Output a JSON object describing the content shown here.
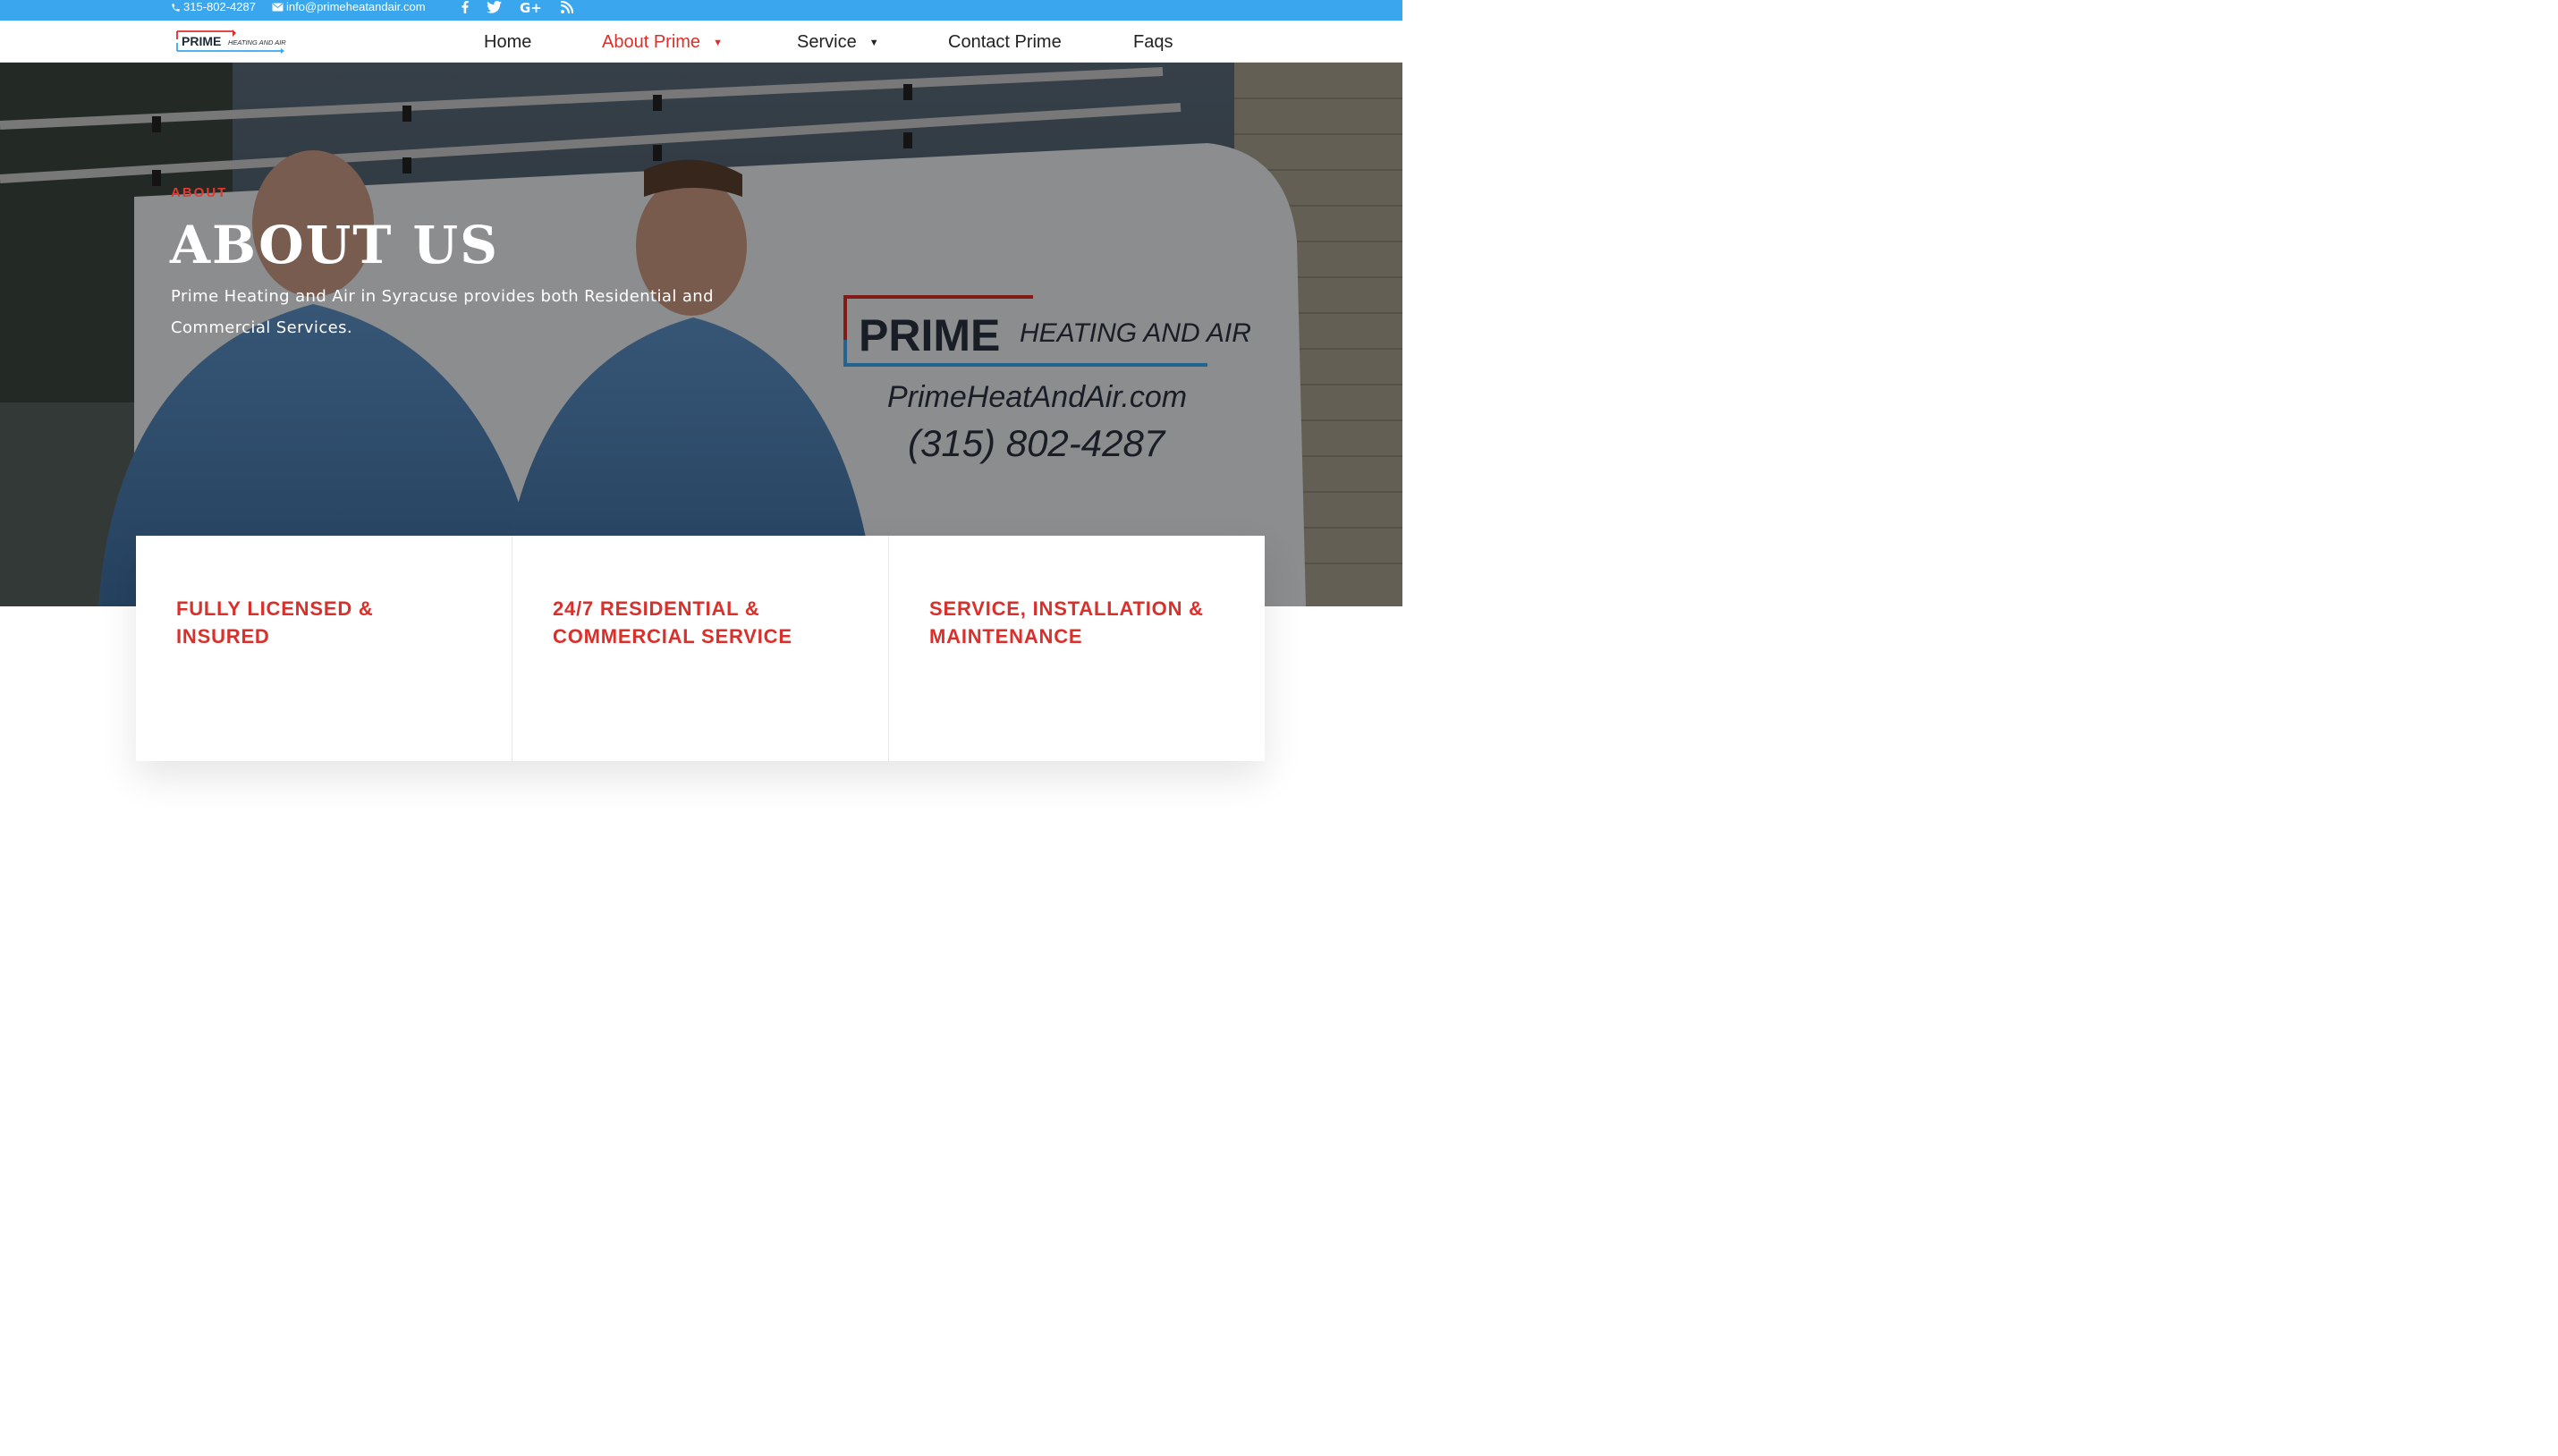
{
  "topbar": {
    "phone": "315-802-4287",
    "email": "info@primeheatandair.com",
    "social_icons": [
      "facebook-icon",
      "twitter-icon",
      "google-plus-icon",
      "rss-icon"
    ]
  },
  "brand": {
    "logo_word": "PRIME",
    "logo_sub": "HEATING AND AIR"
  },
  "nav": {
    "items": [
      {
        "label": "Home",
        "active": false,
        "dropdown": false
      },
      {
        "label": "About Prime",
        "active": true,
        "dropdown": true
      },
      {
        "label": "Service",
        "active": false,
        "dropdown": true
      },
      {
        "label": "Contact Prime",
        "active": false,
        "dropdown": false
      },
      {
        "label": "Faqs",
        "active": false,
        "dropdown": false
      }
    ]
  },
  "hero": {
    "eyebrow": "ABOUT",
    "title": "ABOUT US",
    "description": "Prime Heating and Air in Syracuse provides both Residential and Commercial Services.",
    "van_text": {
      "brand": "PRIME",
      "brand_sub": "HEATING AND AIR",
      "website": "PrimeHeatAndAir.com",
      "phone": "(315) 802-4287"
    }
  },
  "features": [
    {
      "title": "FULLY LICENSED & INSURED"
    },
    {
      "title": "24/7 RESIDENTIAL & COMMERCIAL SERVICE"
    },
    {
      "title": "SERVICE, INSTALLATION & MAINTENANCE"
    }
  ],
  "colors": {
    "topbar": "#3aa6ee",
    "accent_red": "#d9302b",
    "nav_text": "#222222"
  }
}
